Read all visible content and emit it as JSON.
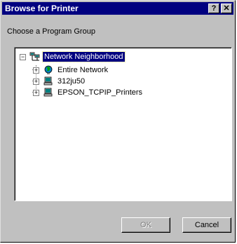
{
  "window": {
    "title": "Browse for Printer",
    "help_glyph": "?",
    "close_glyph": "✕"
  },
  "prompt": "Choose a Program Group",
  "tree": {
    "root": {
      "label": "Network Neighborhood",
      "expander": "−",
      "icon": "network-neighborhood-icon",
      "selected": true
    },
    "children": [
      {
        "label": "Entire Network",
        "expander": "+",
        "icon": "globe-icon"
      },
      {
        "label": "312ju50",
        "expander": "+",
        "icon": "computer-icon"
      },
      {
        "label": "EPSON_TCPIP_Printers",
        "expander": "+",
        "icon": "computer-icon"
      }
    ]
  },
  "buttons": {
    "ok_label": "OK",
    "ok_enabled": false,
    "cancel_label": "Cancel"
  },
  "colors": {
    "titlebar": "#000080",
    "face": "#c0c0c0",
    "selection": "#000080"
  }
}
